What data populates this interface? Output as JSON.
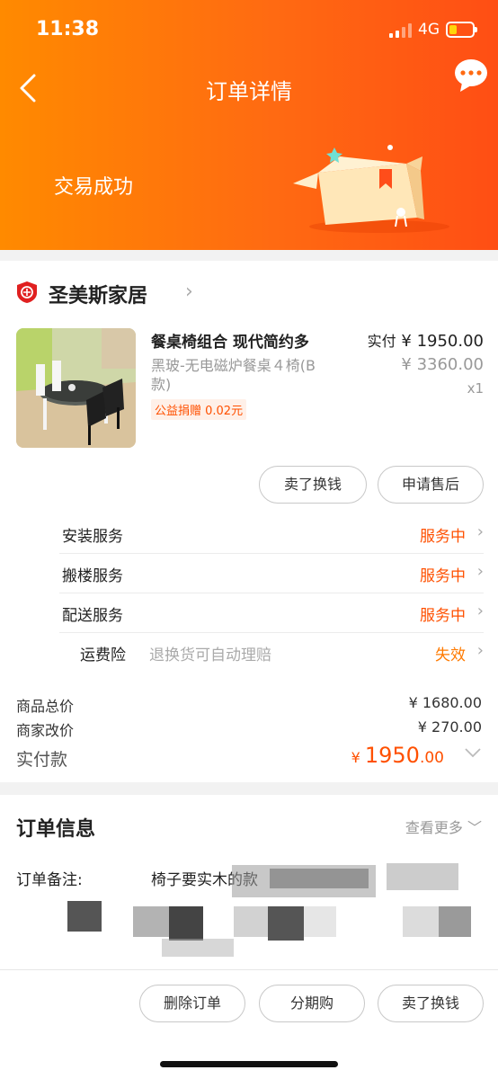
{
  "status_bar": {
    "time": "11:38",
    "network": "4G"
  },
  "header": {
    "title": "订单详情",
    "status": "交易成功"
  },
  "shop": {
    "name": "圣美斯家居"
  },
  "product": {
    "name": "餐桌椅组合 现代简约多",
    "spec": "黑玻-无电磁炉餐桌４椅(B款)",
    "badge": "公益捐赠 0.02元",
    "paid_label": "实付",
    "paid_price": "¥ 1950.00",
    "orig_price": "¥ 3360.00",
    "qty": "x1"
  },
  "item_actions": {
    "sell": "卖了换钱",
    "aftersale": "申请售后"
  },
  "services": [
    {
      "label": "安装服务",
      "desc": "",
      "status": "服务中"
    },
    {
      "label": "搬楼服务",
      "desc": "",
      "status": "服务中"
    },
    {
      "label": "配送服务",
      "desc": "",
      "status": "服务中"
    },
    {
      "label": "运费险",
      "desc": "退换货可自动理赔",
      "status": "失效"
    }
  ],
  "summary": {
    "goods_total_label": "商品总价",
    "goods_total": "¥ 1680.00",
    "seller_adjust_label": "商家改价",
    "seller_adjust": "¥ 270.00",
    "paid_label": "实付款",
    "paid_currency": "¥",
    "paid_int": "1950",
    "paid_dec": ".00"
  },
  "order_info": {
    "title": "订单信息",
    "more": "查看更多",
    "note_label": "订单备注:",
    "note_value": "椅子要实木的款"
  },
  "bottom_actions": {
    "delete": "删除订单",
    "installment": "分期购",
    "sell": "卖了换钱"
  },
  "colors": {
    "accent": "#ff5000",
    "header_start": "#ff8a00",
    "header_end": "#ff4e14"
  }
}
